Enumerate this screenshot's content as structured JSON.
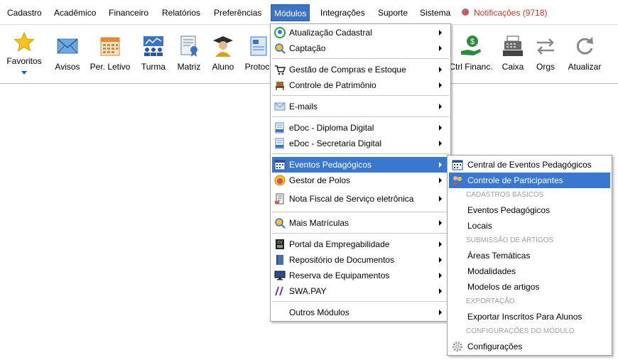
{
  "menubar": {
    "items": [
      {
        "label": "Cadastro"
      },
      {
        "label": "Acadêmico"
      },
      {
        "label": "Financeiro"
      },
      {
        "label": "Relatórios"
      },
      {
        "label": "Preferências"
      },
      {
        "label": "Módulos",
        "active": true
      },
      {
        "label": "Integrações"
      },
      {
        "label": "Suporte"
      },
      {
        "label": "Sistema"
      }
    ],
    "notifications": "Notificações (9718)"
  },
  "toolbar": {
    "favoritos": "Favoritos",
    "avisos": "Avisos",
    "per_letivo": "Per. Letivo",
    "turma": "Turma",
    "matriz": "Matriz",
    "aluno": "Aluno",
    "protocolo": "Protoc",
    "ctrl_financ": "Ctrl Financ.",
    "caixa": "Caixa",
    "orgs": "Orgs",
    "atualizar": "Atualizar"
  },
  "modulos_menu": {
    "items": [
      {
        "label": "Atualização Cadastral",
        "icon": "person-refresh-icon"
      },
      {
        "label": "Captação",
        "icon": "magnifier-people-icon"
      },
      {
        "label": "Gestão de Compras e Estoque",
        "icon": "cart-icon"
      },
      {
        "label": "Controle de Patrimônio",
        "icon": "chair-icon"
      },
      {
        "label": "E-mails",
        "icon": "envelope-icon"
      },
      {
        "label": "eDoc - Diploma Digital",
        "icon": "document-icon"
      },
      {
        "label": "eDoc - Secretaria Digital",
        "icon": "document-icon"
      },
      {
        "label": "Eventos Pedagógicos",
        "icon": "calendar-icon",
        "active": true
      },
      {
        "label": "Gestor de Polos",
        "icon": "face-icon"
      },
      {
        "label": "Nota Fiscal de Serviço eletrônica",
        "icon": "invoice-icon"
      },
      {
        "label": "Mais Matrículas",
        "icon": "magnifier-people-icon"
      },
      {
        "label": "Portal da Empregabilidade",
        "icon": "cv-icon"
      },
      {
        "label": "Repositório de Documentos",
        "icon": "book-icon"
      },
      {
        "label": "Reserva de Equipamentos",
        "icon": "monitor-icon"
      },
      {
        "label": "SWA.PAY",
        "icon": "swapay-icon"
      },
      {
        "label": "Outros Módulos",
        "icon": ""
      }
    ]
  },
  "eventos_menu": {
    "items": [
      {
        "label": "Central de Eventos Pedagógicos",
        "icon": "calendar-icon"
      },
      {
        "label": "Controle de Participantes",
        "icon": "people-icon",
        "active": true
      },
      {
        "label": "Eventos Pedagógicos"
      },
      {
        "label": "Locais"
      },
      {
        "label": "Áreas Temáticas"
      },
      {
        "label": "Modalidades"
      },
      {
        "label": "Modelos de artigos"
      },
      {
        "label": "Exportar Inscritos Para Alunos"
      },
      {
        "label": "Configurações",
        "icon": "gear-icon"
      }
    ],
    "headers": [
      "CADASTROS BÁSICOS",
      "SUBMISSÃO DE ARTIGOS",
      "EXPORTAÇÃO",
      "CONFIGURAÇÕES DO MÓDULO"
    ]
  },
  "colors": {
    "highlight": "#3a78cf",
    "menubar_active": "#3b73c5",
    "notification": "#c0392b"
  }
}
